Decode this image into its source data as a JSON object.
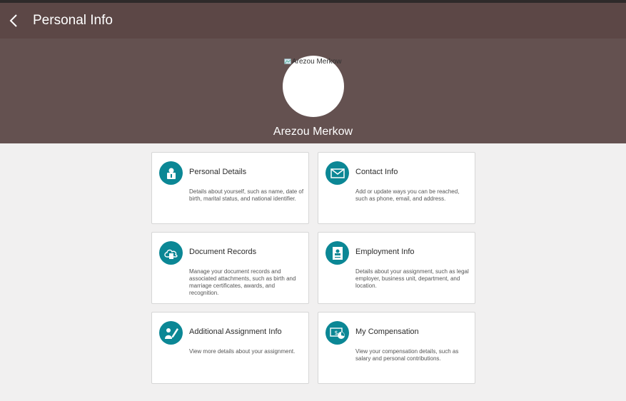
{
  "header": {
    "title": "Personal Info",
    "back_icon": "chevron-left-icon"
  },
  "profile": {
    "avatar_alt": "Arezou Merkow",
    "name": "Arezou Merkow"
  },
  "colors": {
    "header_bg": "#5c4746",
    "hero_bg": "#645150",
    "icon_accent": "#0b8795",
    "page_bg": "#f1f0f0"
  },
  "tiles": [
    {
      "title": "Personal Details",
      "icon": "person-badge-icon",
      "description": "Details about yourself, such as name, date of birth, marital status, and national identifier."
    },
    {
      "title": "Contact Info",
      "icon": "envelope-icon",
      "description": "Add or update ways you can be reached, such as phone, email, and address."
    },
    {
      "title": "Document Records",
      "icon": "cloud-document-icon",
      "description": "Manage your document records and associated attachments, such as birth and marriage certificates, awards, and recognition."
    },
    {
      "title": "Employment Info",
      "icon": "id-card-icon",
      "description": "Details about your assignment, such as legal employer, business unit, department, and location."
    },
    {
      "title": "Additional Assignment Info",
      "icon": "person-edit-icon",
      "description": "View more details about your assignment."
    },
    {
      "title": "My Compensation",
      "icon": "compensation-icon",
      "description": "View your compensation details, such as salary and personal contributions."
    }
  ]
}
